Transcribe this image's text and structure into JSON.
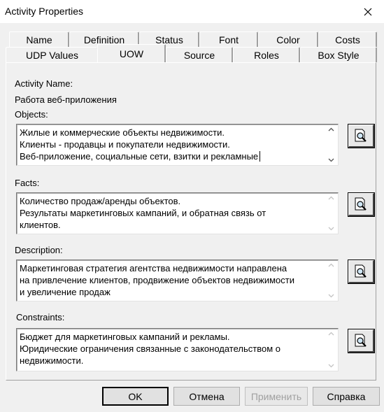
{
  "window": {
    "title": "Activity Properties"
  },
  "tabs_row1": [
    "Name",
    "Definition",
    "Status",
    "Font",
    "Color",
    "Costs"
  ],
  "tabs_row2": [
    "UDP Values",
    "UOW",
    "Source",
    "Roles",
    "Box Style"
  ],
  "active_tab": "UOW",
  "activity_name_label": "Activity Name:",
  "activity_name_value": "Работа веб-приложения",
  "fields": {
    "objects": {
      "label": "Objects:",
      "lines": [
        "Жилые и коммерческие объекты недвижимости.",
        "Клиенты - продавцы и покупатели недвижимости.",
        "Веб-приложение, социальные сети, взитки и рекламные"
      ]
    },
    "facts": {
      "label": "Facts:",
      "lines": [
        "Количество продаж/аренды объектов.",
        "Результаты маркетинговых кампаний, и обратная связь от",
        "клиентов."
      ]
    },
    "description": {
      "label": "Description:",
      "lines": [
        "Маркетинговая стратегия агентства недвижимости направлена",
        "на привлечение клиентов, продвижение объектов недвижимости",
        "и увеличение продаж"
      ]
    },
    "constraints": {
      "label": "Constraints:",
      "lines": [
        "Бюджет для маркетинговых кампаний и рекламы.",
        "Юридические ограничения связанные с законодательством о",
        "недвижимости."
      ]
    }
  },
  "buttons": {
    "ok": "OK",
    "cancel": "Отмена",
    "apply": "Применить",
    "help": "Справка"
  },
  "icons": {
    "close": "close-icon",
    "find": "magnifier-document-icon"
  }
}
